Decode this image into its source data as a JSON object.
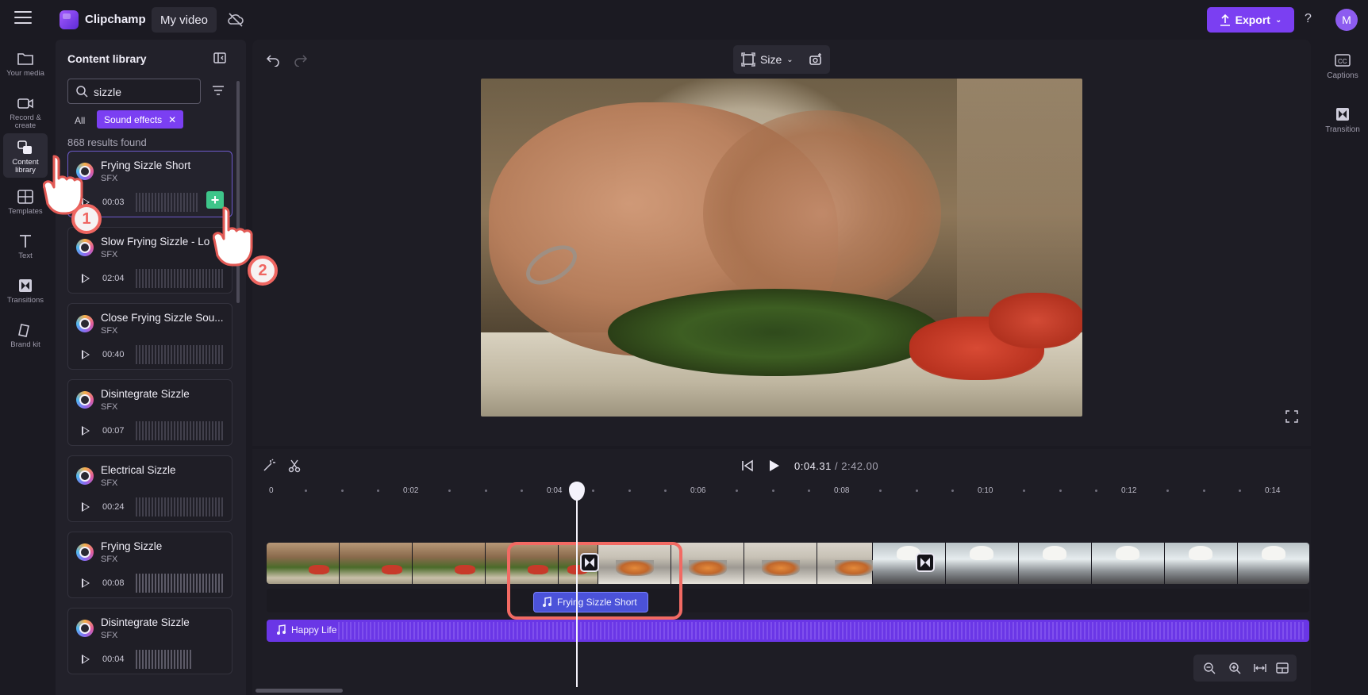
{
  "app": {
    "name": "Clipchamp",
    "project_title": "My video",
    "export_label": "Export",
    "avatar_initial": "M"
  },
  "leftnav": {
    "items": [
      {
        "label": "Your media",
        "icon": "folder-icon"
      },
      {
        "label": "Record & create",
        "icon": "camera-icon"
      },
      {
        "label": "Content library",
        "icon": "content-library-icon",
        "active": true
      },
      {
        "label": "Templates",
        "icon": "templates-icon"
      },
      {
        "label": "Text",
        "icon": "text-icon"
      },
      {
        "label": "Transitions",
        "icon": "transitions-icon"
      },
      {
        "label": "Brand kit",
        "icon": "brand-kit-icon"
      }
    ]
  },
  "library": {
    "title": "Content library",
    "search_value": "sizzle",
    "tab_all": "All",
    "active_filter": "Sound effects",
    "results": "868 results found",
    "items": [
      {
        "title": "Frying Sizzle Short",
        "type": "SFX",
        "duration": "00:03",
        "selected": true
      },
      {
        "title": "Slow Frying Sizzle - Lo",
        "type": "SFX",
        "duration": "02:04"
      },
      {
        "title": "Close Frying Sizzle Sou...",
        "type": "SFX",
        "duration": "00:40"
      },
      {
        "title": "Disintegrate Sizzle",
        "type": "SFX",
        "duration": "00:07"
      },
      {
        "title": "Electrical Sizzle",
        "type": "SFX",
        "duration": "00:24"
      },
      {
        "title": "Frying Sizzle",
        "type": "SFX",
        "duration": "00:08"
      },
      {
        "title": "Disintegrate Sizzle",
        "type": "SFX",
        "duration": "00:04"
      }
    ]
  },
  "preview": {
    "size_label": "Size"
  },
  "rightpanel": {
    "captions_label": "Captions",
    "transition_label": "Transition"
  },
  "timeline": {
    "current_time": "0:04.31",
    "total_time": "/ 2:42.00",
    "ruler_labels": [
      "0",
      "0:02",
      "0:04",
      "0:06",
      "0:08",
      "0:10",
      "0:12",
      "0:14"
    ],
    "sfx_clip_label": "Frying Sizzle Short",
    "music_label": "Happy Life"
  },
  "tutorial": {
    "step1": "1",
    "step2": "2"
  },
  "colors": {
    "accent": "#7b3ff2",
    "add_button": "#3ec58a",
    "highlight": "#f26a63",
    "sfx_clip": "#4b52d9",
    "music_track": "#6a36e6"
  }
}
